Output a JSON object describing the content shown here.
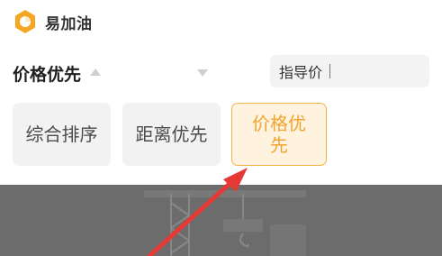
{
  "brand": {
    "name": "易加油",
    "icon": "hexagon-logo-icon",
    "accent_color": "#f5a623"
  },
  "sort": {
    "title": "价格优先",
    "price_field": {
      "label": "指导价"
    }
  },
  "options": [
    {
      "label": "综合排序",
      "selected": false
    },
    {
      "label": "距离优先",
      "selected": false
    },
    {
      "label": "价格优先",
      "selected": true
    }
  ],
  "overlay": {
    "icon": "crane-illustration"
  },
  "annotation": {
    "arrow_color": "#e53935",
    "icon": "red-arrow-icon"
  }
}
